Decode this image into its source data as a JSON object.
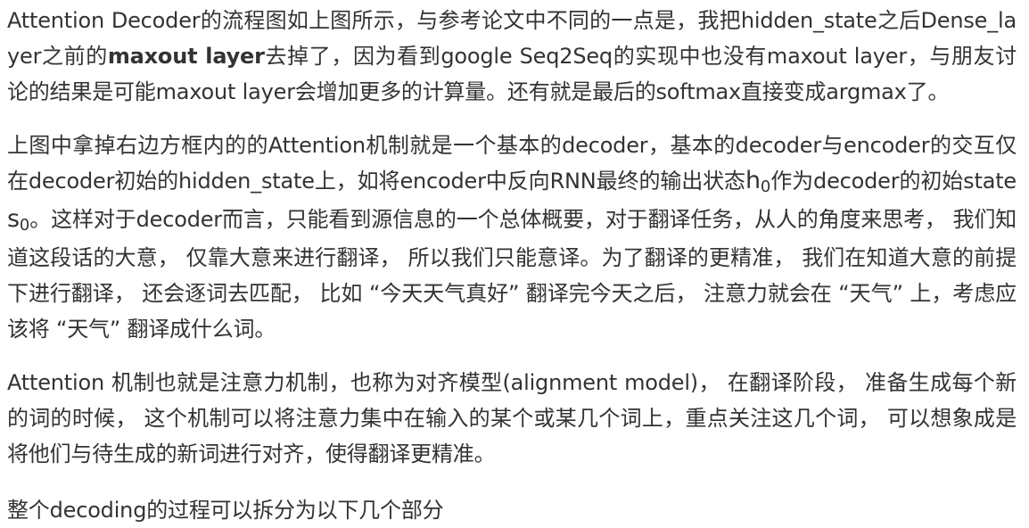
{
  "paragraph1": {
    "before_bold": "Attention Decoder的流程图如上图所示，与参考论文中不同的一点是，我把hidden_state之后Dense_layer之前的",
    "bold": "maxout layer",
    "after_bold": "去掉了，因为看到google Seq2Seq的实现中也没有maxout layer，与朋友讨论的结果是可能maxout layer会增加更多的计算量。还有就是最后的softmax直接变成argmax了。"
  },
  "paragraph2": {
    "part1": "上图中拿掉右边方框内的的Attention机制就是一个基本的decoder，基本的decoder与encoder的交互仅在decoder初始的hidden_state上，如将encoder中反向RNN最终的输出状态",
    "math_h_var": "h",
    "math_h_sub": "0",
    "part2": "作为decoder的初始state ",
    "math_s_var": "s",
    "math_s_sub": "0",
    "part3": "。这样对于decoder而言，只能看到源信息的一个总体概要，对于翻译任务，从人的角度来思考， 我们知道这段话的大意， 仅靠大意来进行翻译， 所以我们只能意译。为了翻译的更精准， 我们在知道大意的前提下进行翻译， 还会逐词去匹配， 比如 “今天天气真好” 翻译完今天之后， 注意力就会在 “天气” 上，考虑应该将 “天气” 翻译成什么词。"
  },
  "paragraph3": {
    "text": "Attention 机制也就是注意力机制，也称为对齐模型(alignment model)， 在翻译阶段， 准备生成每个新的词的时候， 这个机制可以将注意力集中在输入的某个或某几个词上，重点关注这几个词， 可以想象成是将他们与待生成的新词进行对齐，使得翻译更精准。"
  },
  "paragraph4": {
    "text": "整个decoding的过程可以拆分为以下几个部分"
  }
}
